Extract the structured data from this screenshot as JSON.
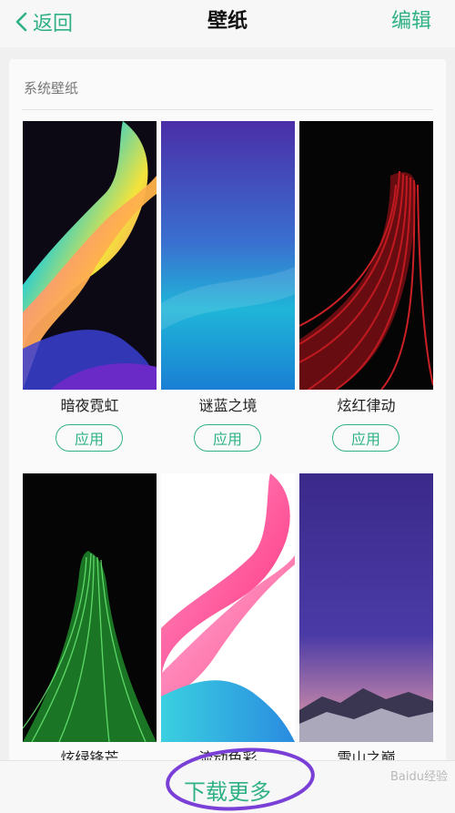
{
  "header": {
    "back_label": "返回",
    "title": "壁纸",
    "edit_label": "编辑"
  },
  "section": {
    "label": "系统壁纸"
  },
  "wallpapers": [
    {
      "name": "暗夜霓虹",
      "apply_label": "应用"
    },
    {
      "name": "谜蓝之境",
      "apply_label": "应用"
    },
    {
      "name": "炫红律动",
      "apply_label": "应用"
    },
    {
      "name": "炫绿锋芒"
    },
    {
      "name": "流动色彩"
    },
    {
      "name": "雪山之巅"
    }
  ],
  "footer": {
    "download_label": "下载更多"
  },
  "watermark": "Baidu经验",
  "colors": {
    "accent": "#2fb184",
    "annotation": "#7a3fd6"
  }
}
